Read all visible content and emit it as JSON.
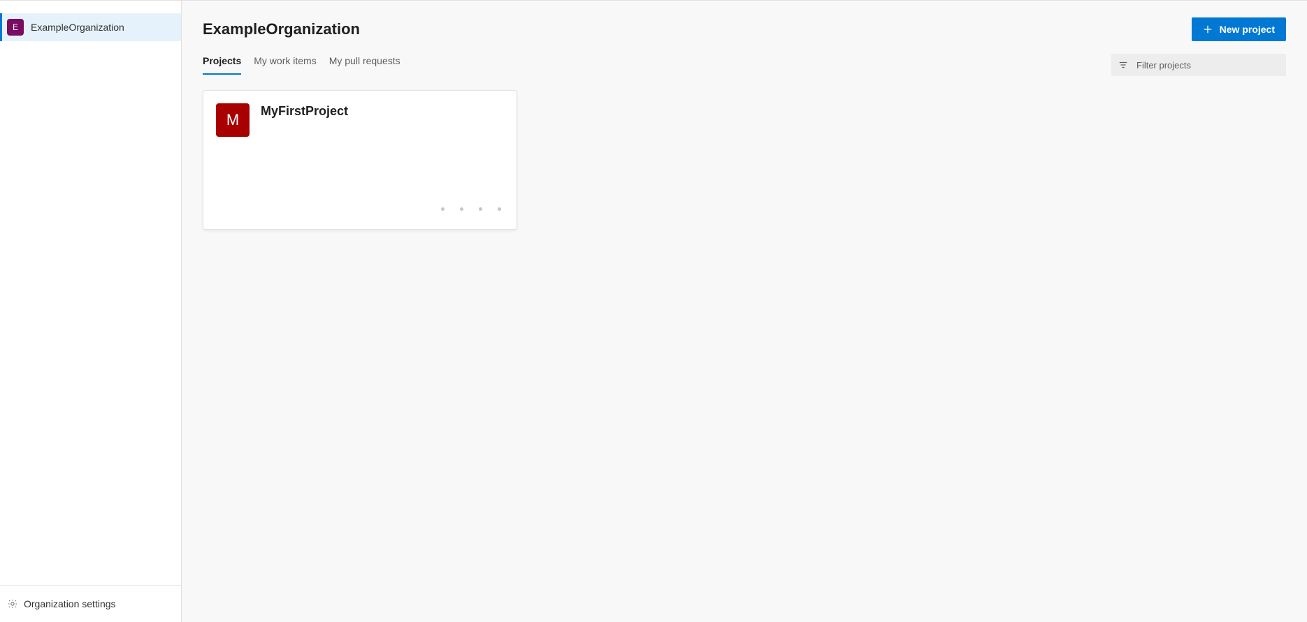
{
  "sidebar": {
    "org": {
      "initial": "E",
      "label": "ExampleOrganization",
      "avatar_bg": "#780d61"
    },
    "settings_label": "Organization settings"
  },
  "header": {
    "title": "ExampleOrganization",
    "new_project_label": "New project"
  },
  "tabs": {
    "projects": "Projects",
    "work_items": "My work items",
    "pull_requests": "My pull requests"
  },
  "filter": {
    "placeholder": "Filter projects"
  },
  "projects": [
    {
      "initial": "M",
      "name": "MyFirstProject",
      "avatar_bg": "#a80000"
    }
  ]
}
